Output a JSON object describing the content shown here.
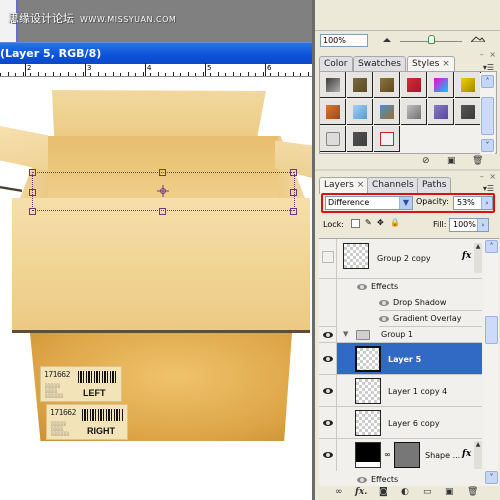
{
  "watermark": {
    "text": "思缘设计论坛",
    "url": "WWW.MISSYUAN.COM"
  },
  "document": {
    "title": "(Layer 5, RGB/8)",
    "ruler_numbers": [
      "2",
      "3",
      "4",
      "5",
      "6"
    ]
  },
  "box_labels": {
    "sticker1_number": "171662",
    "sticker1_word": "LEFT",
    "sticker2_number": "171662",
    "sticker2_word": "RIGHT"
  },
  "navigator": {
    "zoom_value": "100%"
  },
  "styles_panel": {
    "tabs": [
      {
        "label": "Color"
      },
      {
        "label": "Swatches"
      },
      {
        "label": "Styles",
        "close": "×",
        "active": true
      }
    ],
    "swatches": [
      {
        "name": "dark-metal",
        "color": "#3a3a3a",
        "color2": "#b0b0b0"
      },
      {
        "name": "bronze",
        "color": "#7a6a3e",
        "color2": "#5a4a28"
      },
      {
        "name": "gold-brown",
        "color": "#8a7438",
        "color2": "#5e4b20"
      },
      {
        "name": "red-stripes",
        "color": "#d82a3a",
        "color2": "#a01828"
      },
      {
        "name": "rainbow",
        "color": "#ff00cc",
        "color2": "#00ccff"
      },
      {
        "name": "yellow-frame",
        "color": "#f0d000",
        "color2": "#a08800"
      },
      {
        "name": "sunset",
        "color": "#d87830",
        "color2": "#a04818"
      },
      {
        "name": "sky-blue",
        "color": "#a8d0f0",
        "color2": "#5898d8"
      },
      {
        "name": "landscape",
        "color": "#4890d0",
        "color2": "#9a7030"
      },
      {
        "name": "noise",
        "color": "#c0c0c0",
        "color2": "#707070"
      },
      {
        "name": "purple",
        "color": "#8878c8",
        "color2": "#5848a0"
      },
      {
        "name": "dark-gray",
        "color": "#555555",
        "color2": "#3a3a3a"
      },
      {
        "name": "light-outline",
        "color": "#dcdcdc",
        "color2": "#888888"
      },
      {
        "name": "charcoal",
        "color": "#505050",
        "color2": "#404040"
      },
      {
        "name": "red-outline",
        "color": "#f2f2f2",
        "color2": "#d02020"
      }
    ]
  },
  "layers_panel": {
    "tabs": [
      {
        "label": "Layers",
        "close": "×",
        "active": true
      },
      {
        "label": "Channels"
      },
      {
        "label": "Paths"
      }
    ],
    "blend_mode": "Difference",
    "opacity_label": "Opacity:",
    "opacity_value": "53%",
    "lock_label": "Lock:",
    "fill_label": "Fill:",
    "fill_value": "100%",
    "layers": [
      {
        "name": "Group 2 copy",
        "visible": false,
        "fx": "fx"
      },
      {
        "name": "Effects",
        "type": "effects-header"
      },
      {
        "name": "Drop Shadow",
        "type": "effect"
      },
      {
        "name": "Gradient Overlay",
        "type": "effect"
      },
      {
        "name": "Group 1",
        "visible": true,
        "type": "group"
      },
      {
        "name": "Layer 5",
        "visible": true,
        "selected": true
      },
      {
        "name": "Layer 1 copy 4",
        "visible": true
      },
      {
        "name": "Layer 6 copy",
        "visible": true
      },
      {
        "name": "Shape ...",
        "visible": true,
        "fx": "fx"
      },
      {
        "name": "Effects",
        "type": "effects-header"
      }
    ]
  },
  "colors": {
    "titlebar": "#0a52d8",
    "selection": "#316ac5",
    "highlight_border": "#e01010"
  }
}
